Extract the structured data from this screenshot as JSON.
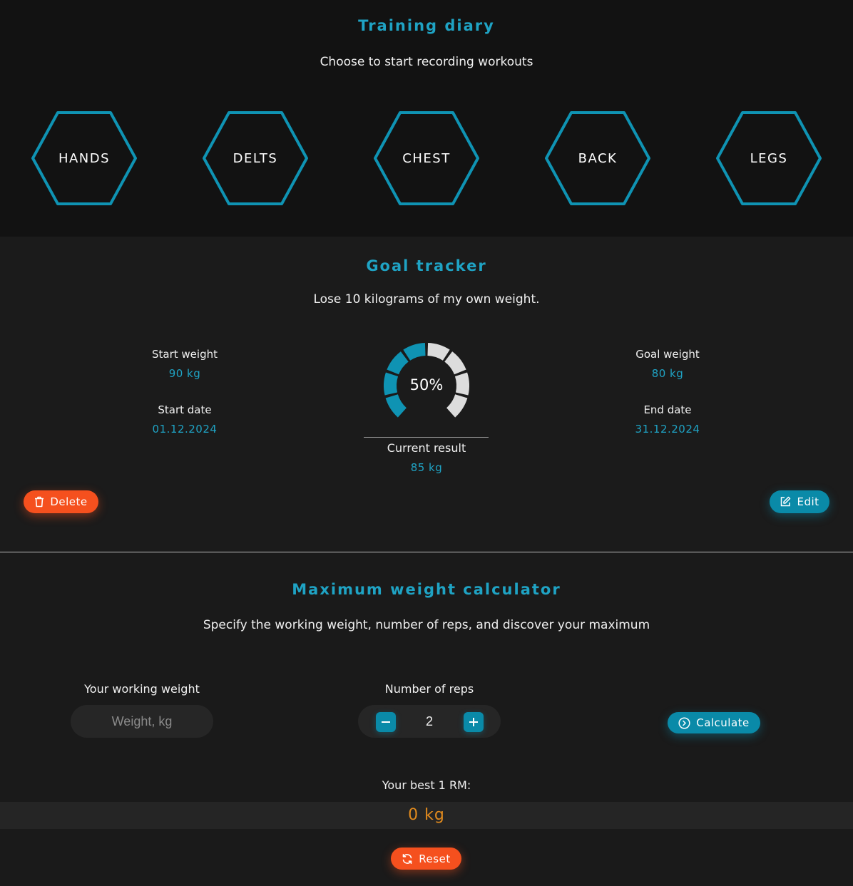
{
  "diary": {
    "title": "Training diary",
    "subtitle": "Choose to start recording workouts",
    "groups": [
      "HANDS",
      "DELTS",
      "CHEST",
      "BACK",
      "LEGS"
    ],
    "accent": "#1fa3c4"
  },
  "goal": {
    "title": "Goal tracker",
    "subtitle": "Lose 10 kilograms of my own weight.",
    "start_weight_label": "Start weight",
    "start_weight": "90 kg",
    "start_date_label": "Start date",
    "start_date": "01.12.2024",
    "goal_weight_label": "Goal weight",
    "goal_weight": "80 kg",
    "end_date_label": "End date",
    "end_date": "31.12.2024",
    "progress_text": "50%",
    "progress_fraction": 0.5,
    "current_label": "Current result",
    "current_value": "85 kg",
    "delete_label": "Delete",
    "edit_label": "Edit"
  },
  "calc": {
    "title": "Maximum weight calculator",
    "subtitle": "Specify the working weight, number of reps, and discover your maximum",
    "weight_label": "Your working weight",
    "weight_placeholder": "Weight, kg",
    "reps_label": "Number of reps",
    "reps_value": "2",
    "calculate_label": "Calculate",
    "result_label": "Your best 1 RM:",
    "result_value": "0 kg",
    "reset_label": "Reset"
  },
  "colors": {
    "accent": "#1fa3c4",
    "danger": "#f5501e",
    "result": "#e08a1e"
  }
}
